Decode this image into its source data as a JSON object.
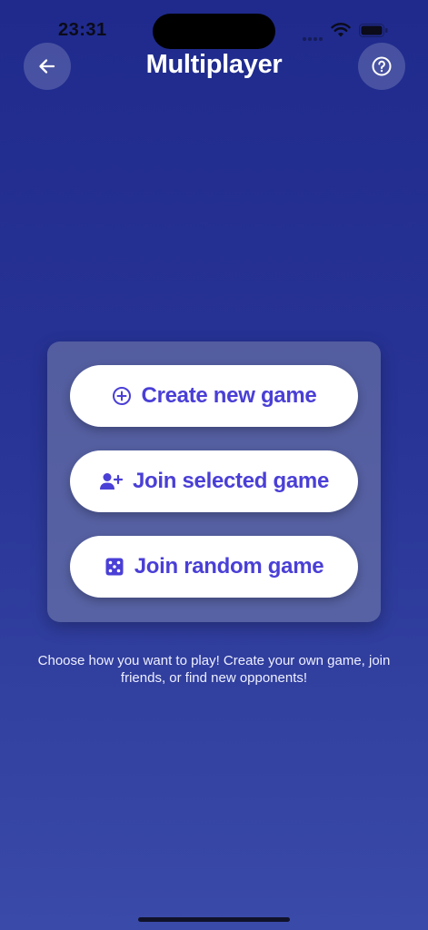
{
  "status_bar": {
    "time": "23:31"
  },
  "header": {
    "title": "Multiplayer",
    "back_icon": "arrow-left-icon",
    "help_icon": "question-circle-icon"
  },
  "menu": {
    "buttons": [
      {
        "label": "Create new game",
        "icon": "plus-circle-icon"
      },
      {
        "label": "Join selected game",
        "icon": "user-plus-icon"
      },
      {
        "label": "Join random game",
        "icon": "dice-icon"
      }
    ]
  },
  "helper_text": "Choose how you want to play! Create your own game, join friends, or find new opponents!",
  "colors": {
    "accent": "#4a3fd6",
    "background_top": "#1f2a8c",
    "background_bottom": "#3a4aa8"
  }
}
